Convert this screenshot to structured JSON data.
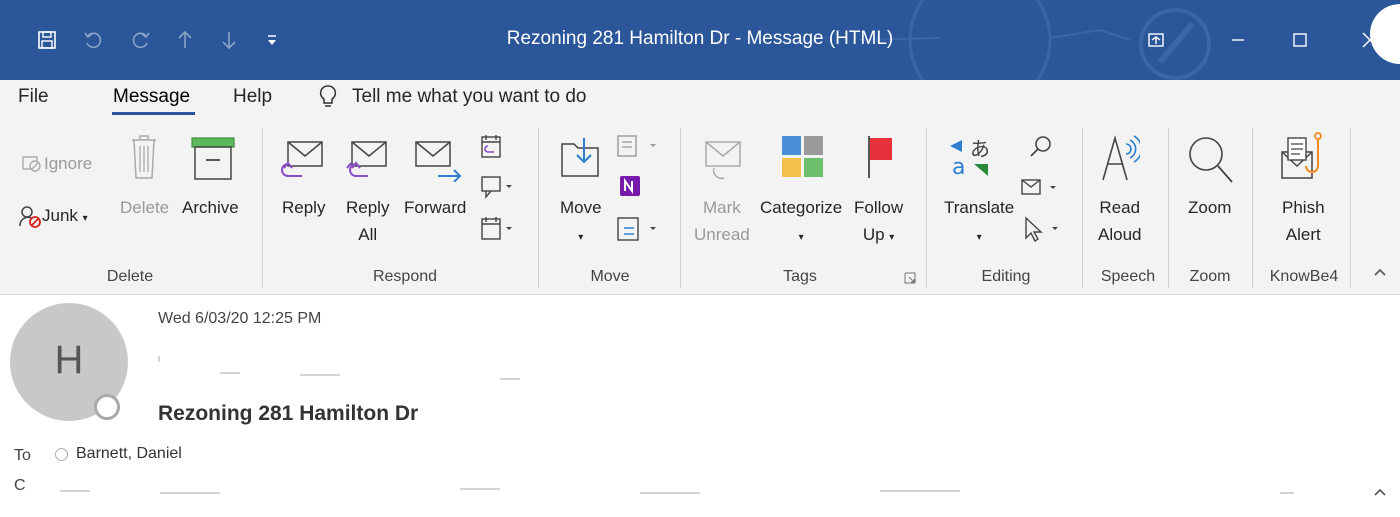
{
  "window": {
    "title": "Rezoning 281 Hamilton Dr  -  Message (HTML)"
  },
  "menu": {
    "tabs": [
      "File",
      "Message",
      "Help"
    ],
    "active": "Message",
    "tell_me": "Tell me what you want to do"
  },
  "ribbon": {
    "delete": {
      "ignore": "Ignore",
      "junk": "Junk",
      "delete": "Delete",
      "archive": "Archive",
      "label": "Delete"
    },
    "respond": {
      "reply": "Reply",
      "reply_all_1": "Reply",
      "reply_all_2": "All",
      "forward": "Forward",
      "label": "Respond"
    },
    "move": {
      "move": "Move",
      "label": "Move"
    },
    "tags": {
      "mark_unread_1": "Mark",
      "mark_unread_2": "Unread",
      "categorize": "Categorize",
      "follow_up_1": "Follow",
      "follow_up_2": "Up",
      "label": "Tags"
    },
    "editing": {
      "translate": "Translate",
      "label": "Editing"
    },
    "speech": {
      "read_aloud_1": "Read",
      "read_aloud_2": "Aloud",
      "label": "Speech"
    },
    "zoom": {
      "zoom": "Zoom",
      "label": "Zoom"
    },
    "knowbe4": {
      "phish_alert_1": "Phish",
      "phish_alert_2": "Alert",
      "label": "KnowBe4"
    }
  },
  "message": {
    "avatar_initial": "H",
    "date": "Wed 6/03/20 12:25 PM",
    "subject": "Rezoning 281 Hamilton Dr",
    "to_label": "To",
    "to_name": "Barnett, Daniel",
    "cc_label": "C"
  },
  "colors": {
    "title_bar": "#2b579a",
    "ribbon_bg": "#f3f3f3",
    "categorize_blue": "#4a90d9",
    "categorize_orange": "#f5c04a",
    "categorize_green": "#6cbf6c",
    "follow_up_flag": "#e8303a",
    "onenote": "#7719aa"
  }
}
